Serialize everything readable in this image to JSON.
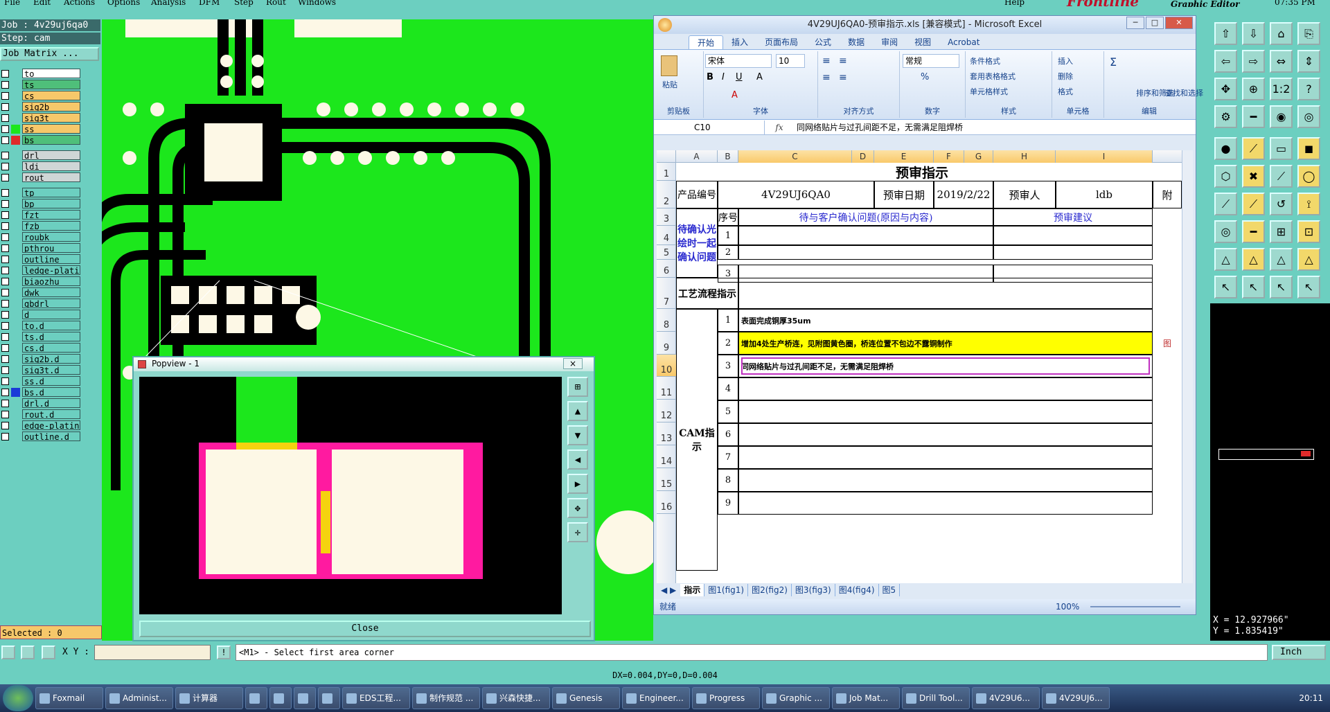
{
  "menubar": {
    "items": [
      "File",
      "Edit",
      "Actions",
      "Options",
      "Analysis",
      "DFM",
      "Step",
      "Rout",
      "Windows",
      "Help"
    ],
    "brand": "Frontline",
    "graphic_editor": "Graphic Editor",
    "time_tr": "07:35 PM"
  },
  "left_panel": {
    "job": "Job : 4v29uj6qa0",
    "step": "Step: cam",
    "job_matrix": "Job Matrix ...",
    "layers": [
      {
        "name": "to",
        "color": "#ffffff",
        "swatch": ""
      },
      {
        "name": "ts",
        "color": "#4fbf7a",
        "swatch": ""
      },
      {
        "name": "cs",
        "color": "#f6c86a",
        "swatch": ""
      },
      {
        "name": "sig2b",
        "color": "#f6c86a",
        "swatch": ""
      },
      {
        "name": "sig3t",
        "color": "#f6c86a",
        "swatch": ""
      },
      {
        "name": "ss",
        "color": "#f6c86a",
        "swatch": "#1ce71c"
      },
      {
        "name": "bs",
        "color": "#4fbf7a",
        "swatch": "#e02a2a"
      },
      {
        "name": "drl",
        "color": "#cfd6d6",
        "swatch": ""
      },
      {
        "name": "ldi",
        "color": "#cfd6d6",
        "swatch": ""
      },
      {
        "name": "rout",
        "color": "#cfd6d6",
        "swatch": ""
      },
      {
        "name": "tp",
        "color": "#6ccfc0",
        "swatch": ""
      },
      {
        "name": "bp",
        "color": "#6ccfc0",
        "swatch": ""
      },
      {
        "name": "fzt",
        "color": "#6ccfc0",
        "swatch": ""
      },
      {
        "name": "fzb",
        "color": "#6ccfc0",
        "swatch": ""
      },
      {
        "name": "roubk",
        "color": "#6ccfc0",
        "swatch": ""
      },
      {
        "name": "pthrou",
        "color": "#6ccfc0",
        "swatch": ""
      },
      {
        "name": "outline",
        "color": "#6ccfc0",
        "swatch": ""
      },
      {
        "name": "ledge-plating",
        "color": "#6ccfc0",
        "swatch": ""
      },
      {
        "name": "biaozhu",
        "color": "#6ccfc0",
        "swatch": ""
      },
      {
        "name": "dwk",
        "color": "#6ccfc0",
        "swatch": ""
      },
      {
        "name": "gbdrl",
        "color": "#6ccfc0",
        "swatch": ""
      },
      {
        "name": "d",
        "color": "#6ccfc0",
        "swatch": ""
      },
      {
        "name": "to.d",
        "color": "#6ccfc0",
        "swatch": ""
      },
      {
        "name": "ts.d",
        "color": "#6ccfc0",
        "swatch": ""
      },
      {
        "name": "cs.d",
        "color": "#6ccfc0",
        "swatch": ""
      },
      {
        "name": "sig2b.d",
        "color": "#6ccfc0",
        "swatch": ""
      },
      {
        "name": "sig3t.d",
        "color": "#6ccfc0",
        "swatch": ""
      },
      {
        "name": "ss.d",
        "color": "#6ccfc0",
        "swatch": ""
      },
      {
        "name": "bs.d",
        "color": "#6ccfc0",
        "swatch": "#1a3ad8"
      },
      {
        "name": "drl.d",
        "color": "#6ccfc0",
        "swatch": ""
      },
      {
        "name": "rout.d",
        "color": "#6ccfc0",
        "swatch": ""
      },
      {
        "name": "edge-plating",
        "color": "#6ccfc0",
        "swatch": ""
      },
      {
        "name": "outline.d",
        "color": "#6ccfc0",
        "swatch": ""
      }
    ],
    "selected": "Selected : 0"
  },
  "popview": {
    "title": "Popview - 1",
    "close_label": "Close",
    "close_x": "×"
  },
  "coords": {
    "x": "X = 12.927966\"",
    "y": "Y = 1.835419\""
  },
  "bottom": {
    "xy_label": "X Y :",
    "xy_value": "",
    "prompt": "<M1> - Select first area corner",
    "units": "Inch",
    "status": "DX=0.004,DY=0,D=0.004"
  },
  "excel": {
    "title": "4V29UJ6QA0-预审指示.xls [兼容模式] - Microsoft Excel",
    "tabs": [
      "开始",
      "插入",
      "页面布局",
      "公式",
      "数据",
      "审阅",
      "视图",
      "Acrobat"
    ],
    "ribbon": {
      "paste": "粘贴",
      "clipboard": "剪贴板",
      "font_name": "宋体",
      "font_size": "10",
      "font_group": "字体",
      "align_group": "对齐方式",
      "number_format": "常规",
      "number_group": "数字",
      "cond_format": "条件格式",
      "table_format": "套用表格格式",
      "cell_style": "单元格样式",
      "style_group": "样式",
      "insert": "插入",
      "delete": "删除",
      "format": "格式",
      "cells_group": "单元格",
      "sort": "排序和筛选",
      "find": "查找和选择",
      "edit_group": "编辑"
    },
    "namebox": "C10",
    "formula": "同网络贴片与过孔间距不足，无需满足阻焊桥",
    "columns": [
      "A",
      "B",
      "C",
      "D",
      "E",
      "F",
      "G",
      "H",
      "I"
    ],
    "rows": [
      "1",
      "2",
      "3",
      "4",
      "5",
      "6",
      "7",
      "8",
      "9",
      "10",
      "11",
      "12",
      "13",
      "14",
      "15",
      "16"
    ],
    "sheet": {
      "title": "预审指示",
      "product_label": "产品编号",
      "product_value": "4V29UJ6QA0",
      "date_label": "预审日期",
      "date_value": "2019/2/22",
      "reviewer_label": "预审人",
      "reviewer_value": "ldb",
      "extra": "附",
      "seq": "序号",
      "confirm_header": "待与客户确认问题(原因与内容)",
      "suggest_header": "预审建议",
      "confirm_group": "待确认光绘时一起确认问题",
      "process_label": "工艺流程指示",
      "cam_label": "CAM指示",
      "items": [
        {
          "n": "1",
          "text": "表面完成铜厚35um",
          "hl": false
        },
        {
          "n": "2",
          "text": "增加4处生产桥连，见附图黄色圈，桥连位置不包边不露铜制作",
          "hl": true
        },
        {
          "n": "3",
          "text": "同网络贴片与过孔间距不足，无需满足阻焊桥",
          "hl": false
        },
        {
          "n": "4",
          "text": "",
          "hl": false
        },
        {
          "n": "5",
          "text": "",
          "hl": false
        },
        {
          "n": "6",
          "text": "",
          "hl": false
        },
        {
          "n": "7",
          "text": "",
          "hl": false
        },
        {
          "n": "8",
          "text": "",
          "hl": false
        },
        {
          "n": "9",
          "text": "",
          "hl": false
        }
      ],
      "q": [
        "1",
        "2",
        "3"
      ],
      "attach": "图"
    },
    "sheet_tabs": [
      "指示",
      "图1(fig1)",
      "图2(fig2)",
      "图3(fig3)",
      "图4(fig4)",
      "图5"
    ],
    "status": "就绪",
    "zoom": "100%"
  },
  "taskbar": {
    "items": [
      "Foxmail",
      "Administ...",
      "计算器",
      "",
      "",
      "",
      "",
      "EDS工程...",
      "制作规范 ...",
      "兴森快捷...",
      "Genesis",
      "Engineer...",
      "Progress",
      "Graphic ...",
      "Job Mat...",
      "Drill Tool...",
      "4V29U6...",
      "4V29UJ6..."
    ],
    "clock": "20:11"
  }
}
